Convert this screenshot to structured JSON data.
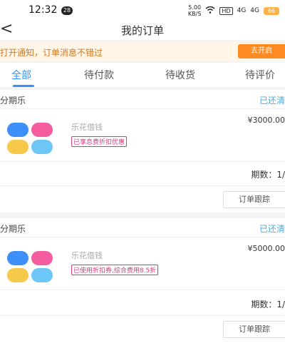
{
  "status_bar": {
    "time": "12:32",
    "notification_count": "28",
    "speed_value": "5.00",
    "speed_unit": "KB/S",
    "hd_label": "HD",
    "network_1": "4G",
    "network_2": "4G",
    "battery": "66"
  },
  "nav": {
    "back_icon": "<",
    "title": "我的订单"
  },
  "notice": {
    "text": "打开通知，订单消息不错过",
    "button": "去开启"
  },
  "tabs": [
    {
      "label": "全部",
      "active": true
    },
    {
      "label": "待付款",
      "active": false
    },
    {
      "label": "待收货",
      "active": false
    },
    {
      "label": "待评价",
      "active": false
    }
  ],
  "orders": [
    {
      "store": "分期乐",
      "status": "已还清",
      "product_name": "乐花借钱",
      "promo": "已享息费折扣优惠",
      "price": "¥3000.00",
      "installments": "期数：1/",
      "track_button": "订单跟踪"
    },
    {
      "store": "分期乐",
      "status": "已还清",
      "product_name": "乐花借钱",
      "promo": "已使用折扣券,综合费用8.5折",
      "price": "¥5000.00",
      "installments": "期数：1/",
      "track_button": "订单跟踪"
    }
  ],
  "colors": {
    "accent": "#2f93ff",
    "notice_bg": "#fff6e7",
    "notice_button": "#ff8a22",
    "status_text": "#4fa9d8",
    "promo": "#d63b7b"
  }
}
